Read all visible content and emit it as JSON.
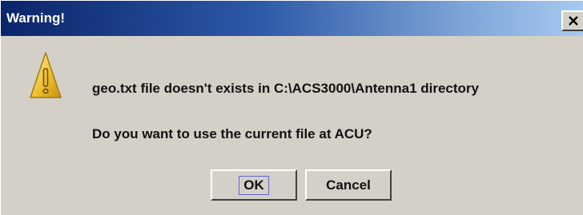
{
  "dialog": {
    "title": "Warning!",
    "message_line_1": "geo.txt file doesn't exists in C:\\ACS3000\\Antenna1 directory",
    "message_line_2": "Do you want to use the current file at ACU?",
    "icon": "warning-icon"
  },
  "buttons": {
    "ok_label": "OK",
    "cancel_label": "Cancel",
    "close_icon": "close-icon"
  },
  "colors": {
    "titlebar_start": "#0a246a",
    "titlebar_end": "#a6caf0",
    "dialog_background": "#d4d0c8",
    "warning_icon_fill": "#f0c030"
  }
}
